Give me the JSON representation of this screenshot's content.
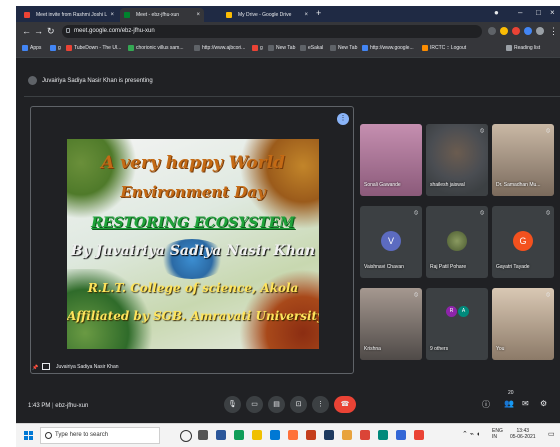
{
  "browser": {
    "tabs": [
      {
        "label": "Meet invite from Rashmi Joshi L",
        "color": "#ea4335"
      },
      {
        "label": "Meet - ebz-jfhu-xun",
        "color": "#00832d"
      },
      {
        "label": "My Drive - Google Drive",
        "color": "#fbbc04"
      }
    ],
    "new_tab": "+",
    "url": "meet.google.com/ebz-jfhu-xun",
    "bookmarks": [
      {
        "label": "Apps",
        "color": "#4285f4"
      },
      {
        "label": "g",
        "color": "#4285f4"
      },
      {
        "label": "TubeDown - The Ul...",
        "color": "#ea4335"
      },
      {
        "label": "chorionic villus sam...",
        "color": "#34a853"
      },
      {
        "label": "http://www.ajbcori...",
        "color": "#5f6368"
      },
      {
        "label": "g",
        "color": "#ea4335"
      },
      {
        "label": "New Tab",
        "color": "#5f6368"
      },
      {
        "label": "eSakal",
        "color": "#5f6368"
      },
      {
        "label": "New Tab",
        "color": "#5f6368"
      },
      {
        "label": "http://www.google...",
        "color": "#4285f4"
      },
      {
        "label": "IRCTC :: Logout",
        "color": "#fb8c00"
      }
    ],
    "reading_list": "Reading list"
  },
  "meet": {
    "presenting_text": "Juvairiya Sadiya Nasir Khan is presenting",
    "stage_label": "Juvairiya Sadiya Nasir Khan",
    "slide": {
      "line1": "A very happy World",
      "line2": "Environment Day",
      "line3": "RESTORING ECOSYSTEM",
      "line4": "By Juvairiya Sadiya Nasir Khan",
      "line5": "R.L.T. College of science, Akola",
      "line6": "Affiliated by SGB. Amravati University"
    },
    "participants": [
      {
        "name": "Sonali Gawande",
        "bg": "#b07a9a"
      },
      {
        "name": "shailesh jaiswal",
        "bg": "#4a4d52"
      },
      {
        "name": "Dr. Samadhan Mu...",
        "bg": "#8a7a6a"
      },
      {
        "name": "Vaishnavi Chavan",
        "initial": "V",
        "bg": "#5c6bc0"
      },
      {
        "name": "Raj Patil Pohare",
        "bg": "#6b7a50"
      },
      {
        "name": "Gayatri Tayade",
        "initial": "G",
        "bg": "#f4511e"
      },
      {
        "name": "Krishna",
        "bg": "#7a7070"
      },
      {
        "name": "9 others",
        "initials": [
          "R",
          "A"
        ]
      },
      {
        "name": "You",
        "bg": "#b8a48f"
      }
    ],
    "meeting_time": "1:43 PM",
    "meeting_code": "ebz-jfhu-xun",
    "participant_count": "20"
  },
  "taskbar": {
    "search_placeholder": "Type here to search",
    "lang": "ENG",
    "lang_region": "IN",
    "time": "13:43",
    "date": "05-06-2021"
  }
}
